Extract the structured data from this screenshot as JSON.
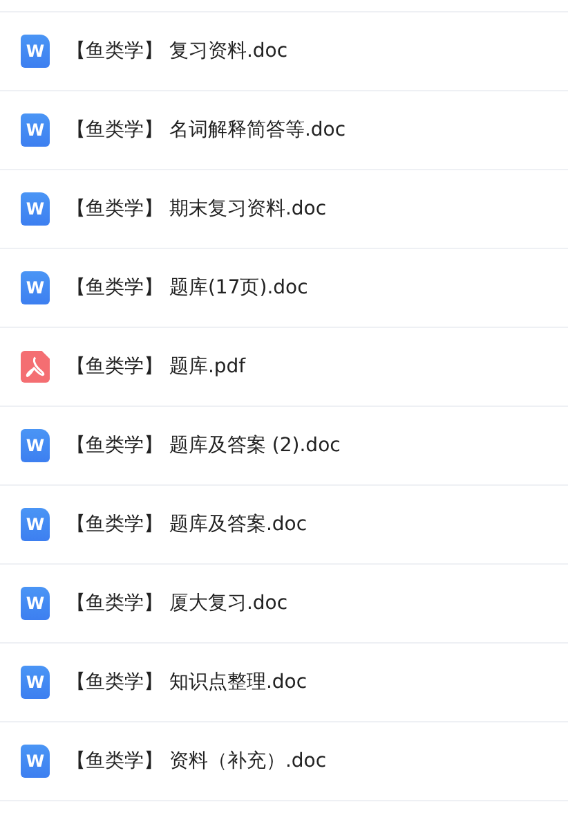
{
  "files": [
    {
      "kind": "doc",
      "icon_letter": "W",
      "name": "【鱼类学】 复习资料.doc"
    },
    {
      "kind": "doc",
      "icon_letter": "W",
      "name": "【鱼类学】 名词解释简答等.doc"
    },
    {
      "kind": "doc",
      "icon_letter": "W",
      "name": "【鱼类学】 期末复习资料.doc"
    },
    {
      "kind": "doc",
      "icon_letter": "W",
      "name": "【鱼类学】 题库(17页).doc"
    },
    {
      "kind": "pdf",
      "name": "【鱼类学】 题库.pdf"
    },
    {
      "kind": "doc",
      "icon_letter": "W",
      "name": "【鱼类学】 题库及答案 (2).doc"
    },
    {
      "kind": "doc",
      "icon_letter": "W",
      "name": "【鱼类学】 题库及答案.doc"
    },
    {
      "kind": "doc",
      "icon_letter": "W",
      "name": "【鱼类学】 厦大复习.doc"
    },
    {
      "kind": "doc",
      "icon_letter": "W",
      "name": "【鱼类学】 知识点整理.doc"
    },
    {
      "kind": "doc",
      "icon_letter": "W",
      "name": "【鱼类学】 资料（补充）.doc"
    }
  ]
}
